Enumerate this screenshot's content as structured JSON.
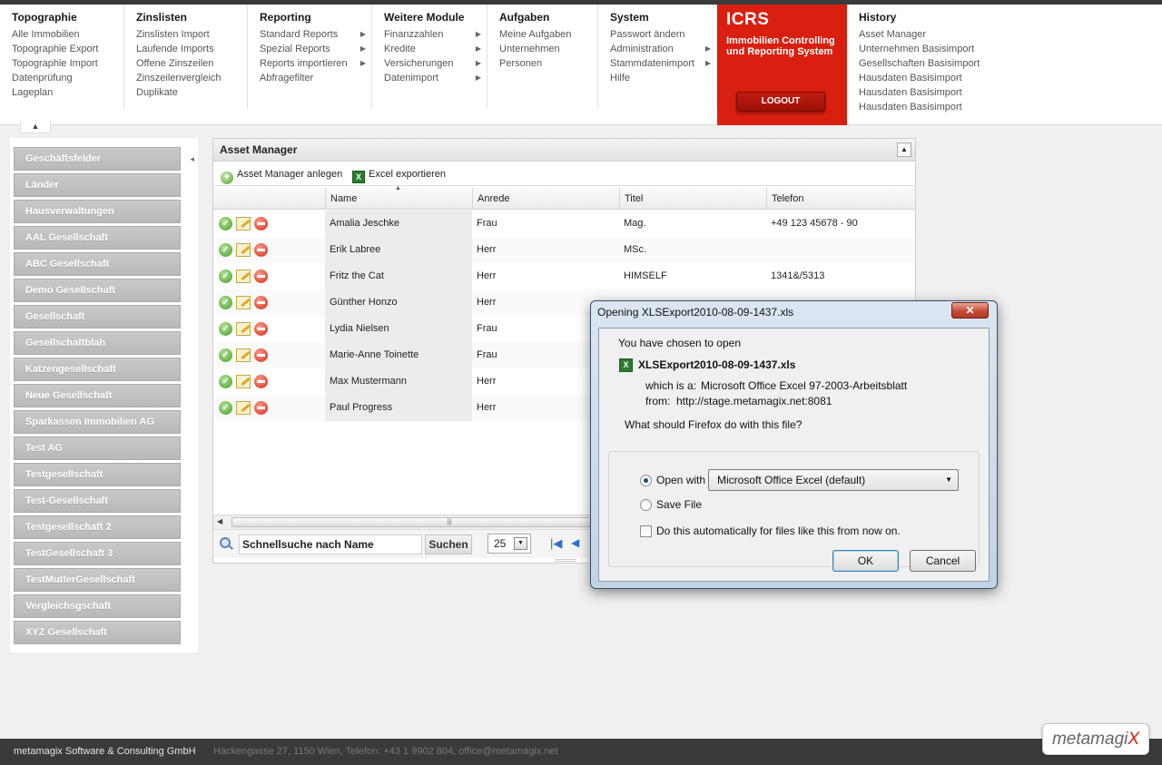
{
  "nav": {
    "columns": [
      {
        "title": "Topographie",
        "items": [
          {
            "label": "Alle Immobilien",
            "submenu": false
          },
          {
            "label": "Topographie Export",
            "submenu": false
          },
          {
            "label": "Topographie Import",
            "submenu": false
          },
          {
            "label": "Datenprüfung",
            "submenu": false
          },
          {
            "label": "Lageplan",
            "submenu": false
          }
        ]
      },
      {
        "title": "Zinslisten",
        "items": [
          {
            "label": "Zinslisten Import",
            "submenu": false
          },
          {
            "label": "Laufende Imports",
            "submenu": false
          },
          {
            "label": "Offene Zinszeilen",
            "submenu": false
          },
          {
            "label": "Zinszeilenvergleich",
            "submenu": false
          },
          {
            "label": "Duplikate",
            "submenu": false
          }
        ]
      },
      {
        "title": "Reporting",
        "items": [
          {
            "label": "Standard Reports",
            "submenu": true
          },
          {
            "label": "Spezial Reports",
            "submenu": true
          },
          {
            "label": "Reports importieren",
            "submenu": true
          },
          {
            "label": "Abfragefilter",
            "submenu": false
          }
        ]
      },
      {
        "title": "Weitere Module",
        "items": [
          {
            "label": "Finanzzahlen",
            "submenu": true
          },
          {
            "label": "Kredite",
            "submenu": true
          },
          {
            "label": "Versicherungen",
            "submenu": true
          },
          {
            "label": "Datenimport",
            "submenu": true
          }
        ]
      },
      {
        "title": "Aufgaben",
        "items": [
          {
            "label": "Meine Aufgaben",
            "submenu": false
          },
          {
            "label": "Unternehmen",
            "submenu": false
          },
          {
            "label": "Personen",
            "submenu": false
          }
        ]
      },
      {
        "title": "System",
        "items": [
          {
            "label": "Passwort ändern",
            "submenu": false
          },
          {
            "label": "Administration",
            "submenu": true
          },
          {
            "label": "Stammdatenimport",
            "submenu": true
          },
          {
            "label": "Hilfe",
            "submenu": false
          }
        ]
      }
    ],
    "history": {
      "title": "History",
      "items": [
        "Asset Manager",
        "Unternehmen Basisimport",
        "Gesellschaften Basisimport",
        "Hausdaten Basisimport",
        "Hausdaten Basisimport",
        "Hausdaten Basisimport"
      ]
    },
    "brand": {
      "title": "ICRS",
      "subtitle": "Immobilien Controlling und Reporting System",
      "logout": "LOGOUT",
      "color": "#d81f10"
    }
  },
  "sidebar": {
    "items": [
      "Geschäftsfelder",
      "Länder",
      "Hausverwaltungen",
      "AAL Gesellschaft",
      "ABC Gesellschaft",
      "Demo Gesellschaft",
      "Gesellschaft",
      "Gesellschaftblah",
      "Katzengesellschaft",
      "Neue Gesellschaft",
      "Sparkassen Immobilien AG",
      "Test AG",
      "Testgesellschaft",
      "Test-Gesellschaft",
      "Testgesellschaft 2",
      "TestGesellschaft 3",
      "TestMutterGesellschaft",
      "Vergleichsgschaft",
      "XYZ Gesellschaft"
    ]
  },
  "panel": {
    "title": "Asset Manager",
    "toolbar": {
      "add": "Asset Manager anlegen",
      "export": "Excel exportieren"
    },
    "columns": {
      "name": "Name",
      "anrede": "Anrede",
      "titel": "Titel",
      "telefon": "Telefon"
    },
    "rows": [
      {
        "name": "Amalia Jeschke",
        "anrede": "Frau",
        "titel": "Mag.",
        "telefon": "+49 123 45678 - 90"
      },
      {
        "name": "Erik Labree",
        "anrede": "Herr",
        "titel": "MSc.",
        "telefon": ""
      },
      {
        "name": "Fritz the Cat",
        "anrede": "Herr",
        "titel": "HIMSELF",
        "telefon": "1341&/5313"
      },
      {
        "name": "Günther Honzo",
        "anrede": "Herr",
        "titel": "",
        "telefon": ""
      },
      {
        "name": "Lydia Nielsen",
        "anrede": "Frau",
        "titel": "",
        "telefon": ""
      },
      {
        "name": "Marie-Anne Toinette",
        "anrede": "Frau",
        "titel": "",
        "telefon": ""
      },
      {
        "name": "Max Mustermann",
        "anrede": "Herr",
        "titel": "",
        "telefon": ""
      },
      {
        "name": "Paul Progress",
        "anrede": "Herr",
        "titel": "",
        "telefon": ""
      }
    ],
    "pager": {
      "search_value": "Schnellsuche nach Name",
      "search_button": "Suchen",
      "page_size": "25"
    }
  },
  "dialog": {
    "title": "Opening XLSExport2010-08-09-1437.xls",
    "close": "✕",
    "intro": "You have chosen to open",
    "filename": "XLSExport2010-08-09-1437.xls",
    "which_is_label": "which is a:",
    "which_is_value": "Microsoft Office Excel 97-2003-Arbeitsblatt",
    "from_label": "from:",
    "from_value": "http://stage.metamagix.net:8081",
    "question": "What should Firefox do with this file?",
    "open_with": "Open with",
    "open_with_app": "Microsoft Office Excel (default)",
    "save_file": "Save File",
    "auto": "Do this automatically for files like this from now on.",
    "ok": "OK",
    "cancel": "Cancel"
  },
  "footer": {
    "company": "metamagix Software & Consulting GmbH",
    "address": "Hackengasse 27, 1150 Wien, Telefon: +43 1 9902 804, office@metamagix.net",
    "logo_main": "metamagi",
    "logo_accent": "X"
  }
}
